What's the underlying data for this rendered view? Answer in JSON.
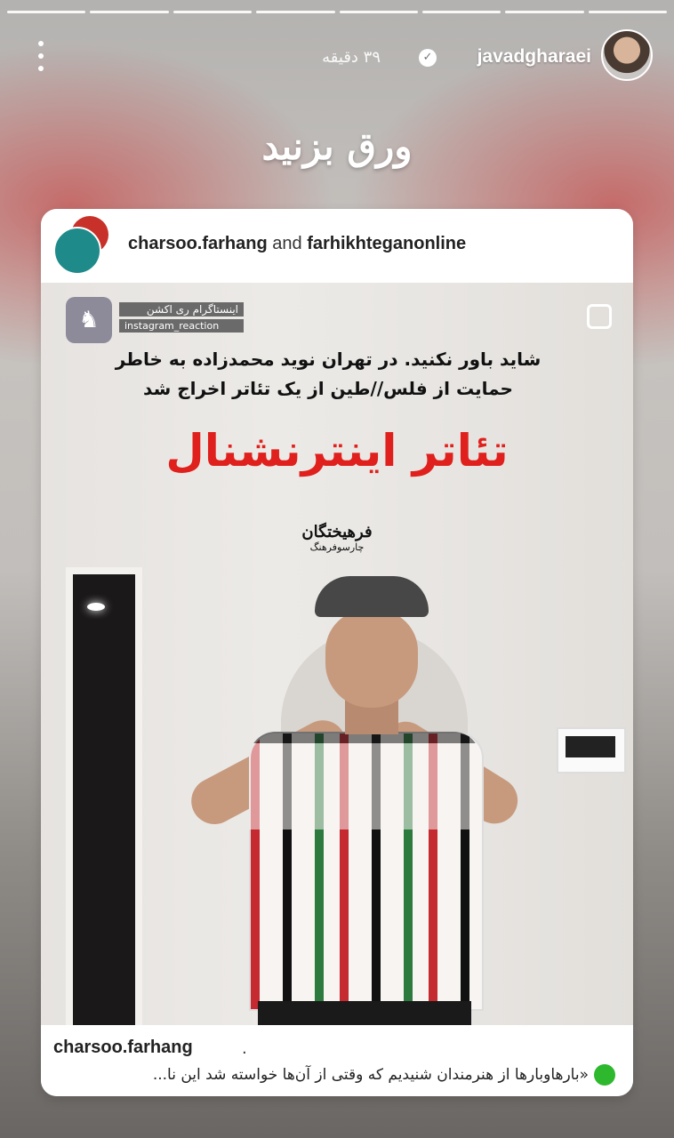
{
  "story": {
    "progress_segments": 8,
    "username": "javadgharaei",
    "time": "۳۹ دقیقه",
    "swipe_text": "ورق بزنید"
  },
  "post": {
    "author_primary": "charsoo.farhang",
    "collab_joiner": "and",
    "author_secondary": "farhikhteganonline",
    "badge_line1": "اینستاگرام ری اکشن",
    "badge_line2": "instagram_reaction",
    "news_line1": "شاید باور نکنید. در تهران نوید محمدزاده به خاطر",
    "news_line2": "حمایت از فلس//طین از یک تئاتر اخراج شد",
    "headline": "تئاتر اینترنشنال",
    "signature": "فرهیختگان",
    "signature_sub": "چارسوفرهنگ"
  },
  "caption": {
    "username": "charsoo.farhang",
    "dot": ".",
    "text": "«بارهاوبارها از هنرمندان شنیدیم که وقتی از آن‌ها خواسته شد این نا..."
  },
  "colors": {
    "headline_red": "#e0201c",
    "caption_green_dot": "#2db82d"
  },
  "icons": [
    "more-vert-icon",
    "verified-badge-icon",
    "multi-image-icon"
  ]
}
